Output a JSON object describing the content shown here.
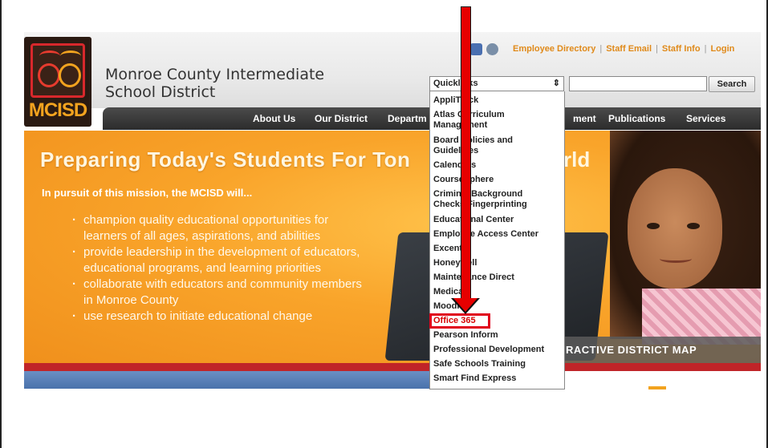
{
  "header": {
    "logo_text": "MCISD",
    "district_name_line1": "Monroe County Intermediate",
    "district_name_line2": "School District",
    "utility_links": [
      "Employee Directory",
      "Staff Email",
      "Staff Info",
      "Login"
    ],
    "quicklinks_label": "Quicklinks",
    "search_value": "",
    "search_button": "Search"
  },
  "nav": {
    "items": [
      "About Us",
      "Our District",
      "Departm",
      "ment",
      "Publications",
      "Services"
    ]
  },
  "hero": {
    "title_left": "Preparing Today's Students For Ton",
    "title_right": "rld",
    "subtitle": "In pursuit of this mission, the MCISD will...",
    "bullets": [
      "champion quality educational opportunities for learners of all ages, aspirations, and abilities",
      "provide leadership in the development of educators, educational programs, and learning priorities",
      "collaborate with educators and community members in Monroe County",
      "use research to initiate educational change"
    ],
    "map_label": "RACTIVE DISTRICT MAP"
  },
  "dropdown": {
    "items": [
      "AppliTrack",
      "Atlas Curriculum Management",
      "Board Policies and Guidelines",
      "Calendars",
      "CourseSphere",
      "Criminal Background Checks/Fingerprinting",
      "Educational Center",
      "Employee Access Center",
      "Excent",
      "Honeywell",
      "Maintenance Direct",
      "Medicaid",
      "Moodle",
      "Office 365",
      "Pearson Inform",
      "Professional Development",
      "Safe Schools Training",
      "Smart Find Express"
    ],
    "highlighted": "Office 365"
  },
  "colors": {
    "accent_orange": "#f2a31f",
    "annotation_red": "#e60000",
    "nav_dark": "#2c2c2c"
  }
}
